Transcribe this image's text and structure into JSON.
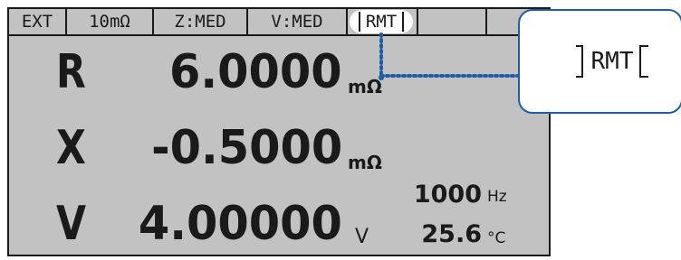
{
  "statusbar": {
    "ext": "EXT",
    "range": "10mΩ",
    "z": "Z:MED",
    "v": "V:MED",
    "rmt": "RMT"
  },
  "readings": {
    "r_label": "R",
    "r_value": "6.0000",
    "r_unit": "mΩ",
    "x_label": "X",
    "x_value": "-0.5000",
    "x_unit": "mΩ",
    "v_label": "V",
    "v_value": "4.00000",
    "v_unit": "V"
  },
  "side": {
    "freq_value": "1000",
    "freq_unit": "Hz",
    "temp_value": "25.6",
    "temp_unit": "°C"
  },
  "callout": {
    "label": "RMT"
  },
  "colors": {
    "lcd_bg": "#c2c2c2",
    "callout_border": "#1e5ea8",
    "leader_line": "#1e5ea8"
  }
}
